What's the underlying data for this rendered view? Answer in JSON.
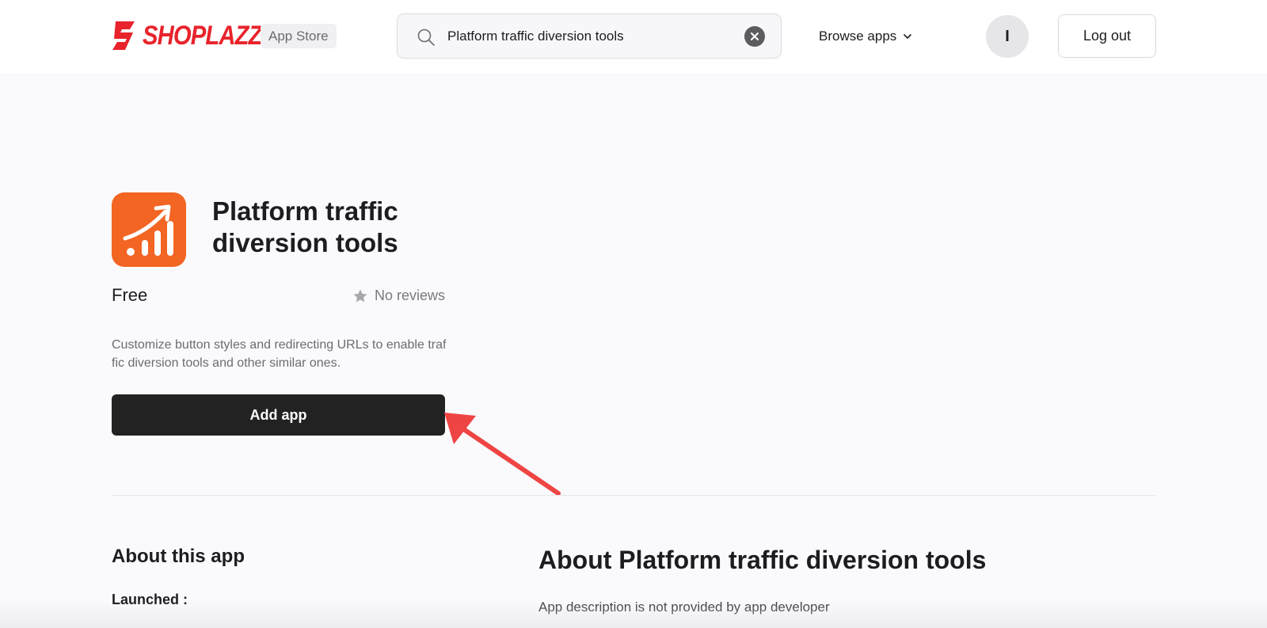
{
  "header": {
    "logo_text": "SHOPLAZZA",
    "store_badge": "App Store",
    "search": {
      "value": "Platform traffic diversion tools",
      "icon": "search-icon",
      "clear_icon": "close-icon"
    },
    "browse_label": "Browse apps",
    "avatar_initial": "I",
    "logout_label": "Log out"
  },
  "app": {
    "icon": "trending-up-chart-icon",
    "icon_color": "#f26522",
    "title": "Platform traffic diversion tools",
    "price": "Free",
    "reviews": "No reviews",
    "description": "Customize button styles and redirecting URLs to enable traffic diversion tools and other similar ones.",
    "add_button": "Add app"
  },
  "about": {
    "heading": "About this app",
    "launched_label": "Launched :",
    "title": "About Platform traffic diversion tools",
    "description": "App description is not provided by app developer"
  },
  "colors": {
    "brand_red": "#e8232b",
    "accent_orange": "#f26522",
    "button_dark": "#222222",
    "annotation_arrow": "#ef4444"
  }
}
